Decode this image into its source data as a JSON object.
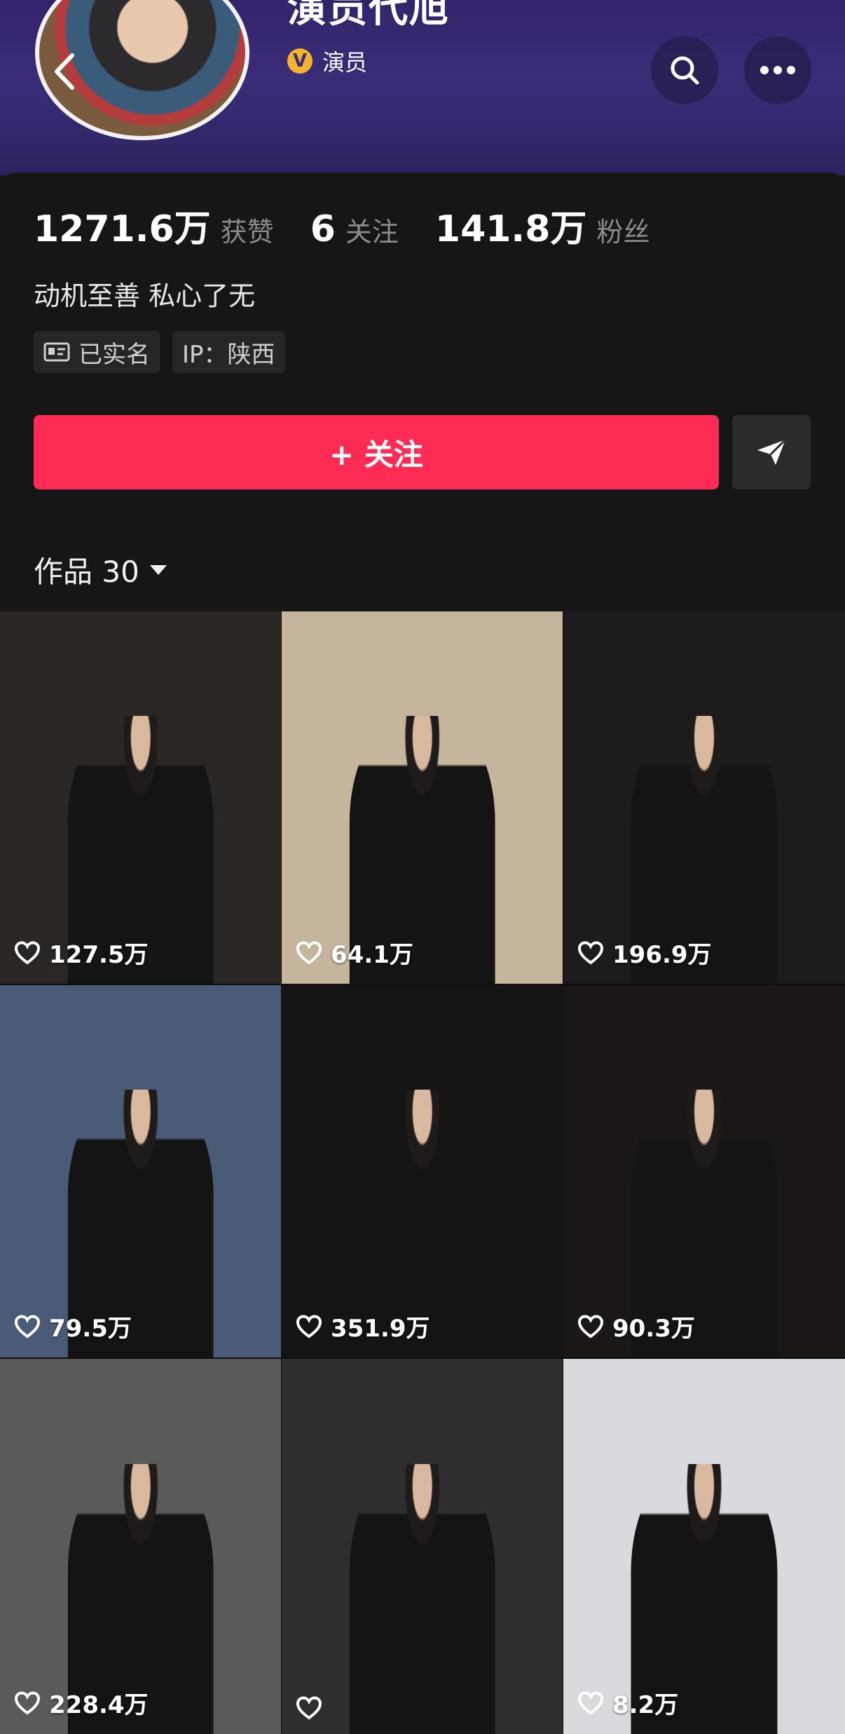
{
  "profile": {
    "name": "演员代旭",
    "verified_label": "演员",
    "verified_badge": "V"
  },
  "stats": {
    "likes_value": "1271.6万",
    "likes_label": "获赞",
    "following_value": "6",
    "following_label": "关注",
    "followers_value": "141.8万",
    "followers_label": "粉丝"
  },
  "bio": "动机至善 私心了无",
  "tags": {
    "verified_name": "已实名",
    "ip": "IP：陕西"
  },
  "actions": {
    "follow_label": "+ 关注"
  },
  "works": {
    "label": "作品 30",
    "items": [
      {
        "likes": "127.5万",
        "tone": "#2a2624"
      },
      {
        "likes": "64.1万",
        "tone": "#c4b59c"
      },
      {
        "likes": "196.9万",
        "tone": "#1c1c1e"
      },
      {
        "likes": "79.5万",
        "tone": "#4a5b78"
      },
      {
        "likes": "351.9万",
        "tone": "#141414"
      },
      {
        "likes": "90.3万",
        "tone": "#1a1716"
      },
      {
        "likes": "228.4万",
        "tone": "#5a5a58"
      },
      {
        "likes": "",
        "tone": "#2e2e2e"
      },
      {
        "likes": "8.2万",
        "tone": "#d8dadd"
      }
    ]
  },
  "icons": {
    "back": "chevron-left-icon",
    "search": "search-icon",
    "more": "more-icon",
    "share": "send-icon",
    "id_card": "id-card-icon",
    "dropdown": "caret-down-icon",
    "heart": "heart-icon"
  },
  "colors": {
    "accent": "#fe2c55",
    "header": "#3a2c78",
    "background": "#161616",
    "badge": "#f4b32e"
  }
}
